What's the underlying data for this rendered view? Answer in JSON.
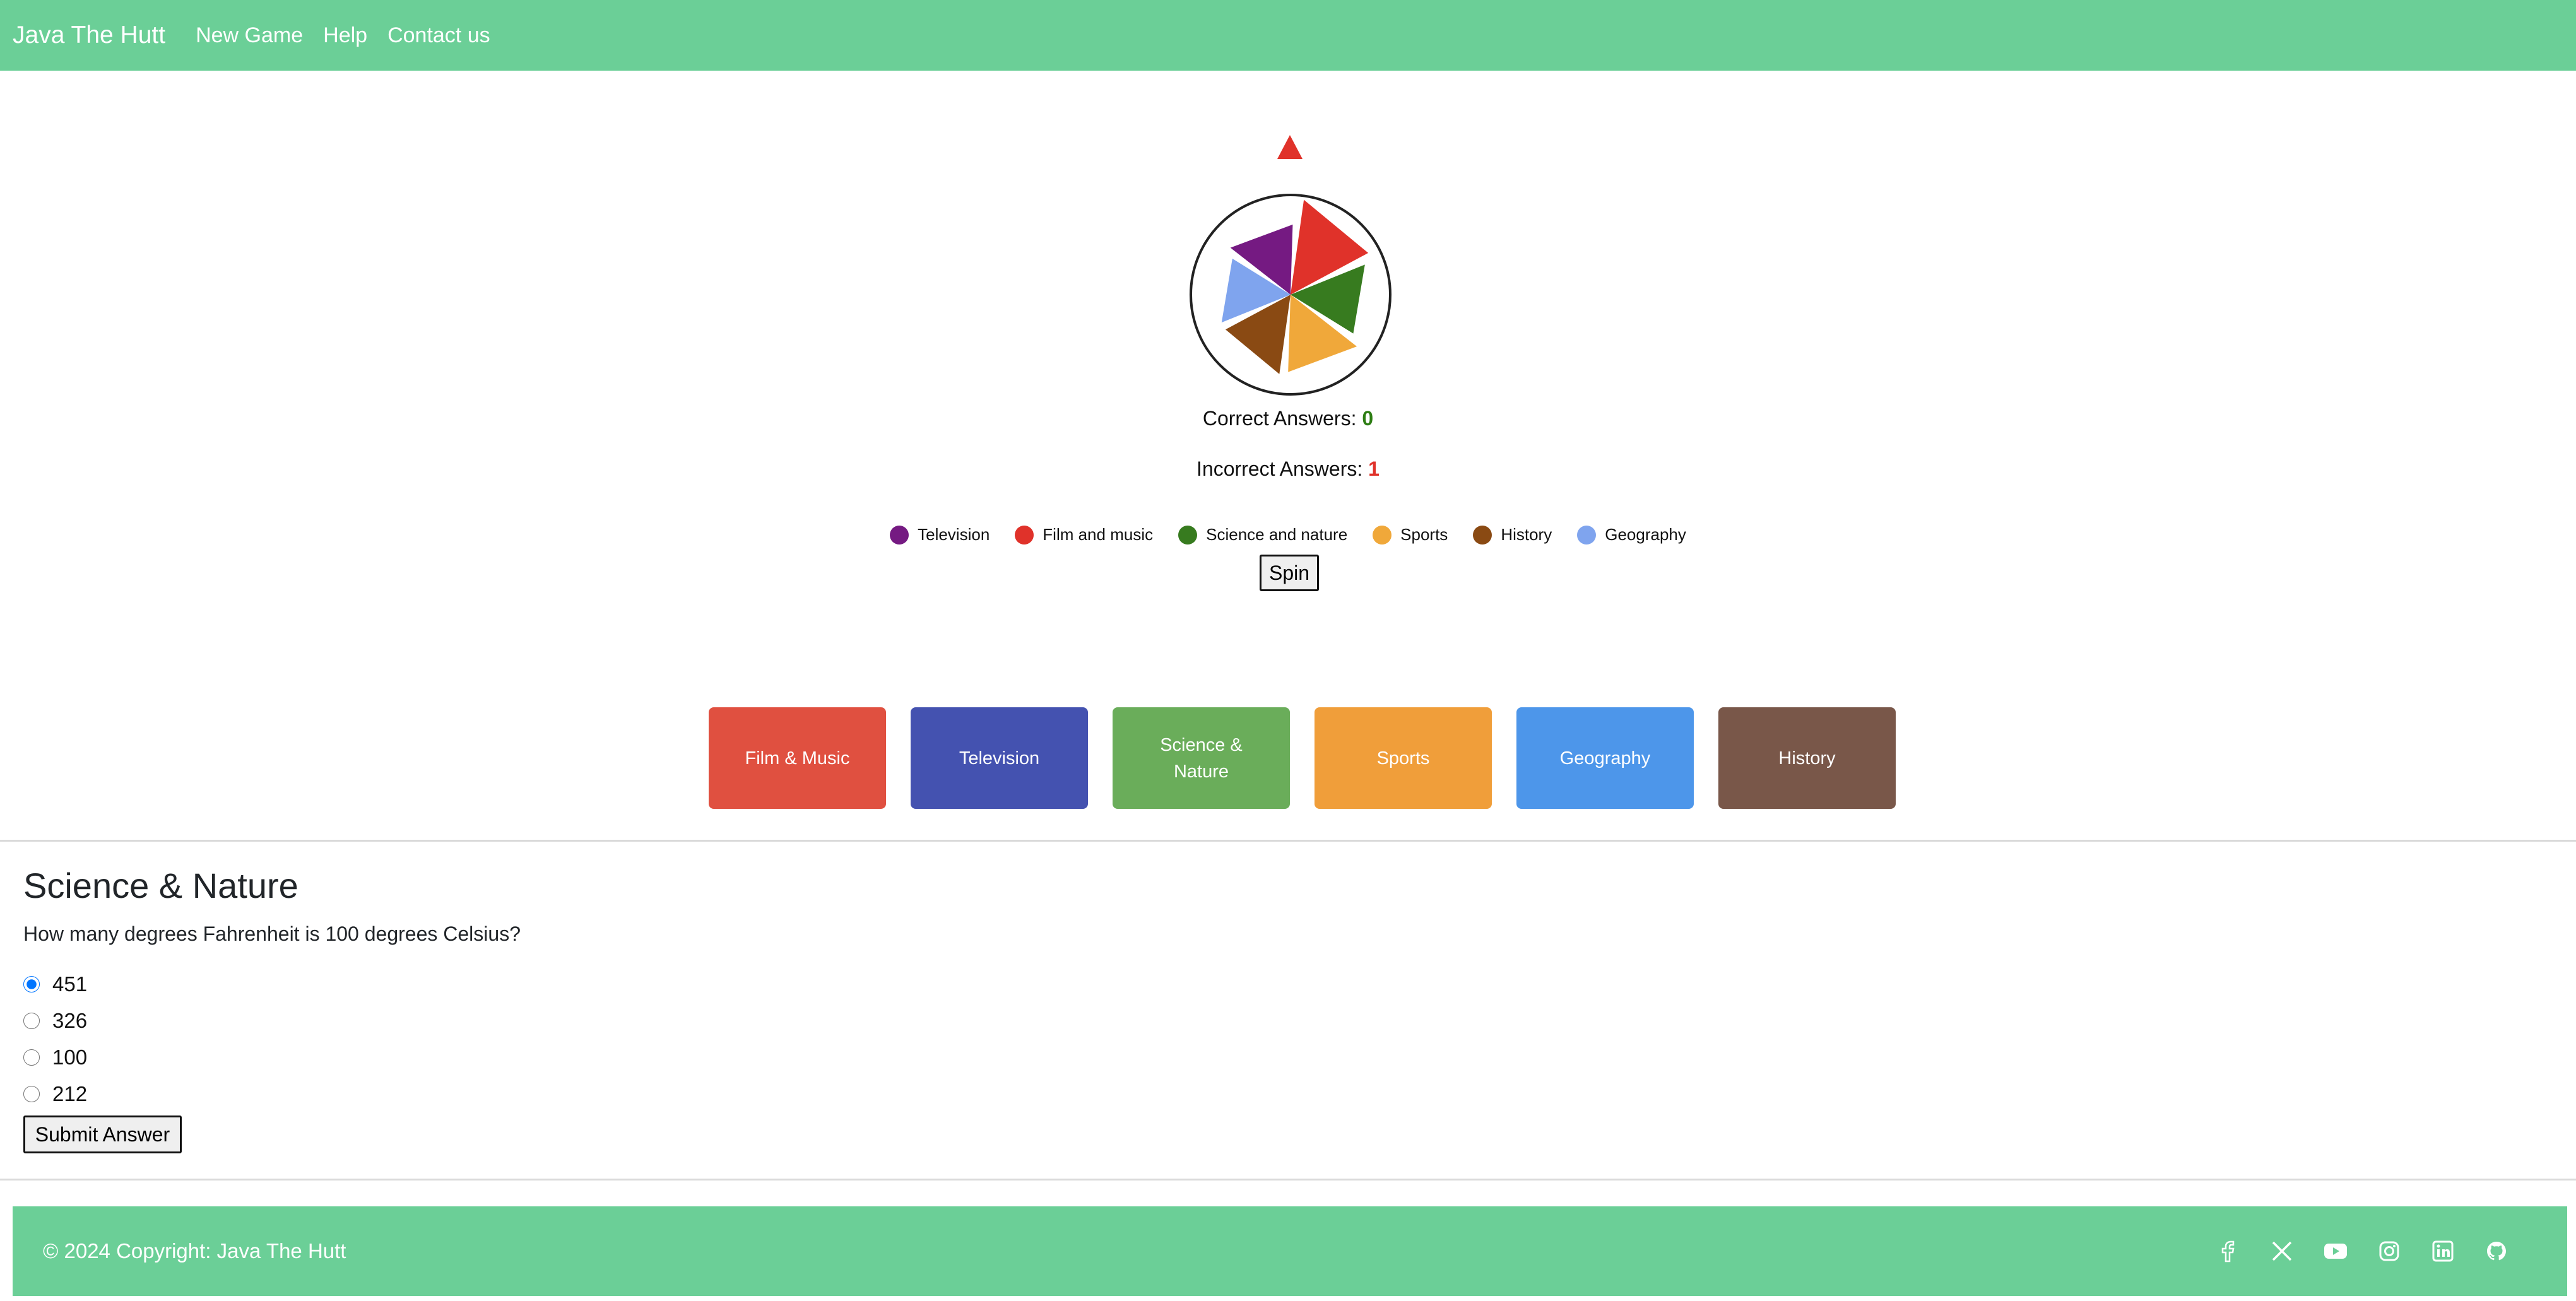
{
  "navbar": {
    "brand": "Java The Hutt",
    "links": [
      "New Game",
      "Help",
      "Contact us"
    ],
    "background": "#6bcf97"
  },
  "wheel": {
    "pointer_color": "#e0322a",
    "segments": [
      {
        "category": "Film and music",
        "color": "#e0322a"
      },
      {
        "category": "Science and nature",
        "color": "#377b1f"
      },
      {
        "category": "Sports",
        "color": "#f0a83a"
      },
      {
        "category": "History",
        "color": "#8a4a13"
      },
      {
        "category": "Geography",
        "color": "#7fa4ee"
      },
      {
        "category": "Television",
        "color": "#751a82"
      }
    ]
  },
  "score": {
    "correct_label": "Correct Answers:",
    "correct_value": "0",
    "incorrect_label": "Incorrect Answers:",
    "incorrect_value": "1"
  },
  "legend": [
    {
      "label": "Television",
      "color": "#751a82"
    },
    {
      "label": "Film and music",
      "color": "#e0322a"
    },
    {
      "label": "Science and nature",
      "color": "#377b1f"
    },
    {
      "label": "Sports",
      "color": "#f0a83a"
    },
    {
      "label": "History",
      "color": "#8a4a13"
    },
    {
      "label": "Geography",
      "color": "#7fa4ee"
    }
  ],
  "spin_label": "Spin",
  "categories": [
    {
      "label": "Film & Music",
      "color": "#e05040"
    },
    {
      "label": "Television",
      "color": "#4452b0"
    },
    {
      "label": "Science & Nature",
      "color": "#6aad5a"
    },
    {
      "label": "Sports",
      "color": "#f09e3a"
    },
    {
      "label": "Geography",
      "color": "#4d96ea"
    },
    {
      "label": "History",
      "color": "#795749"
    }
  ],
  "question": {
    "title": "Science & Nature",
    "text": "How many degrees Fahrenheit is 100 degrees Celsius?",
    "answers": [
      "451",
      "326",
      "100",
      "212"
    ],
    "selected": "451",
    "submit_label": "Submit Answer"
  },
  "footer": {
    "copyright": "© 2024 Copyright: Java The Hutt",
    "social_icons": [
      "facebook-icon",
      "x-icon",
      "youtube-icon",
      "instagram-icon",
      "linkedin-icon",
      "github-icon"
    ]
  }
}
